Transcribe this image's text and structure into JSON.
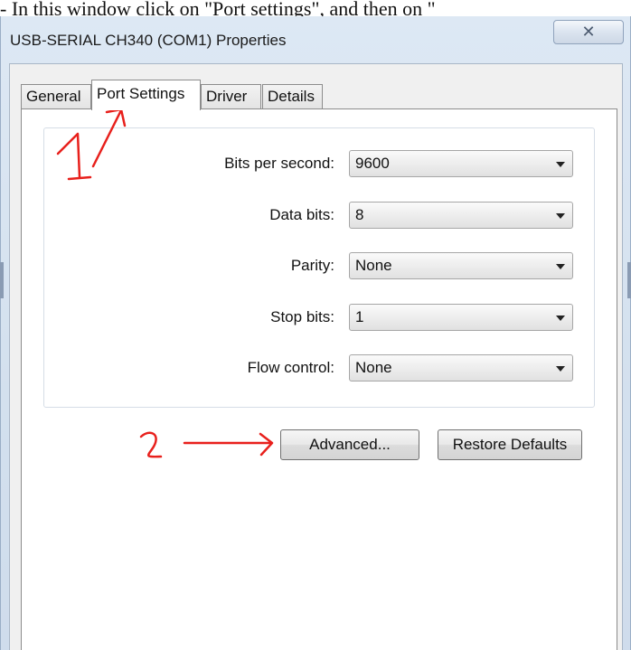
{
  "caption": "- In this window click on \"Port settings\", and then on \"",
  "window": {
    "title": "USB-SERIAL CH340 (COM1) Properties",
    "close_glyph": "✕"
  },
  "tabs": [
    {
      "label": "General"
    },
    {
      "label": "Port Settings",
      "active": true
    },
    {
      "label": "Driver"
    },
    {
      "label": "Details"
    }
  ],
  "settings": {
    "bits_per_second": {
      "label": "Bits per second:",
      "value": "9600"
    },
    "data_bits": {
      "label": "Data bits:",
      "value": "8"
    },
    "parity": {
      "label": "Parity:",
      "value": "None"
    },
    "stop_bits": {
      "label": "Stop bits:",
      "value": "1"
    },
    "flow_control": {
      "label": "Flow control:",
      "value": "None"
    }
  },
  "buttons": {
    "advanced": "Advanced...",
    "restore_defaults": "Restore Defaults"
  },
  "annotations": {
    "color": "#e8201c"
  }
}
